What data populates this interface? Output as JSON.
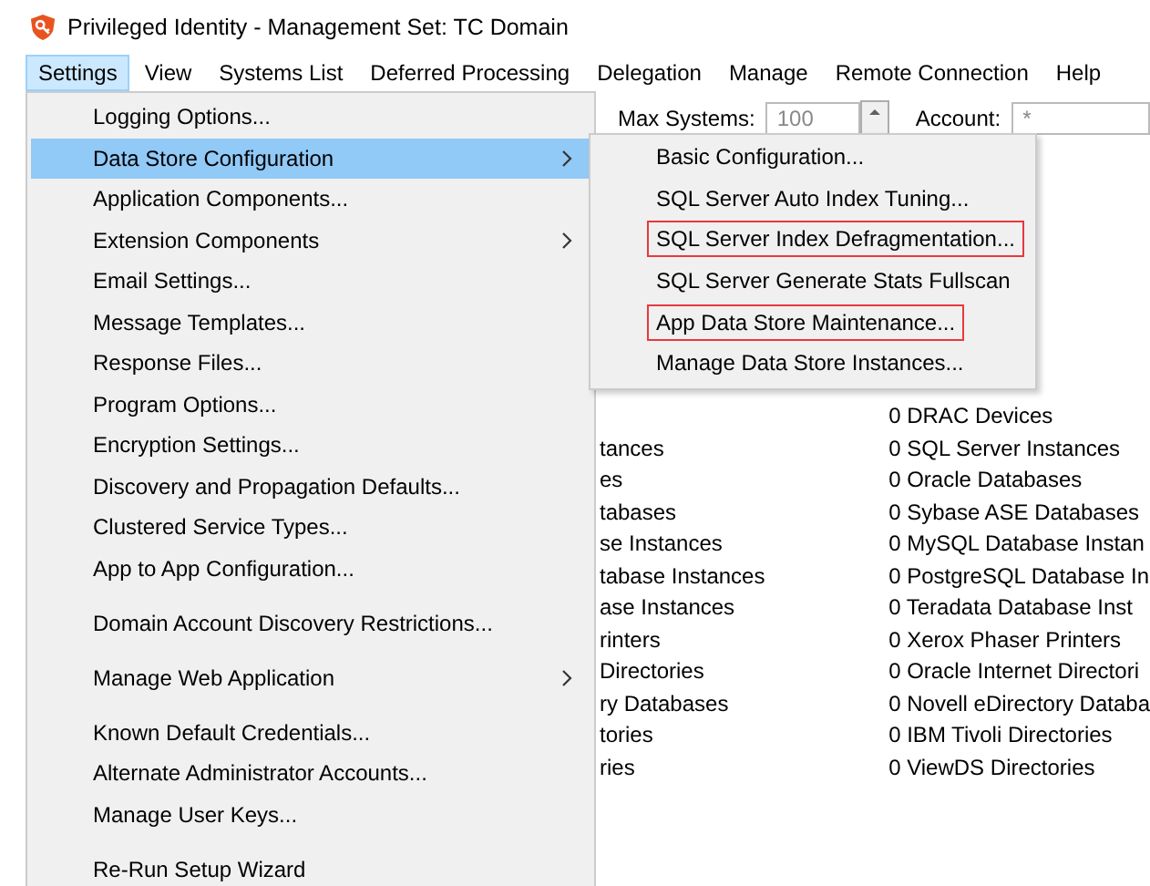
{
  "window": {
    "title": "Privileged Identity - Management Set: TC Domain"
  },
  "menu_bar": [
    {
      "label": "Settings",
      "selected": true
    },
    {
      "label": "View",
      "selected": false
    },
    {
      "label": "Systems List",
      "selected": false
    },
    {
      "label": "Deferred Processing",
      "selected": false
    },
    {
      "label": "Delegation",
      "selected": false
    },
    {
      "label": "Manage",
      "selected": false
    },
    {
      "label": "Remote Connection",
      "selected": false
    },
    {
      "label": "Help",
      "selected": false
    }
  ],
  "toolbar": {
    "max_systems_label": "Max Systems:",
    "max_systems_value": "100",
    "account_label": "Account:",
    "account_value": "*"
  },
  "list_left": [
    "tances",
    "es",
    "tabases",
    "se Instances",
    "tabase Instances",
    "ase Instances",
    "rinters",
    "Directories",
    "ry Databases",
    "tories",
    "ries"
  ],
  "list_right": [
    "0 DRAC Devices",
    "0 SQL Server Instances",
    "0 Oracle Databases",
    "0 Sybase ASE Databases",
    "0 MySQL Database Instan",
    "0 PostgreSQL Database In",
    "0 Teradata Database Inst",
    "0 Xerox Phaser Printers",
    "0 Oracle Internet Directori",
    "0 Novell eDirectory Databa",
    "0 IBM Tivoli Directories",
    "0 ViewDS Directories"
  ],
  "settings_menu": [
    {
      "kind": "item",
      "label": "Logging Options...",
      "selected": false,
      "has_submenu": false
    },
    {
      "kind": "item",
      "label": "Data Store Configuration",
      "selected": true,
      "has_submenu": true
    },
    {
      "kind": "item",
      "label": "Application Components...",
      "selected": false,
      "has_submenu": false
    },
    {
      "kind": "item",
      "label": "Extension Components",
      "selected": false,
      "has_submenu": true
    },
    {
      "kind": "item",
      "label": "Email Settings...",
      "selected": false,
      "has_submenu": false
    },
    {
      "kind": "item",
      "label": "Message Templates...",
      "selected": false,
      "has_submenu": false
    },
    {
      "kind": "item",
      "label": "Response Files...",
      "selected": false,
      "has_submenu": false
    },
    {
      "kind": "item",
      "label": "Program Options...",
      "selected": false,
      "has_submenu": false
    },
    {
      "kind": "item",
      "label": "Encryption Settings...",
      "selected": false,
      "has_submenu": false
    },
    {
      "kind": "item",
      "label": "Discovery and Propagation Defaults...",
      "selected": false,
      "has_submenu": false
    },
    {
      "kind": "item",
      "label": "Clustered Service Types...",
      "selected": false,
      "has_submenu": false
    },
    {
      "kind": "item",
      "label": "App to App Configuration...",
      "selected": false,
      "has_submenu": false
    },
    {
      "kind": "separator"
    },
    {
      "kind": "item",
      "label": "Domain Account Discovery Restrictions...",
      "selected": false,
      "has_submenu": false
    },
    {
      "kind": "separator"
    },
    {
      "kind": "item",
      "label": "Manage Web Application",
      "selected": false,
      "has_submenu": true
    },
    {
      "kind": "separator"
    },
    {
      "kind": "item",
      "label": "Known Default Credentials...",
      "selected": false,
      "has_submenu": false
    },
    {
      "kind": "item",
      "label": "Alternate Administrator Accounts...",
      "selected": false,
      "has_submenu": false
    },
    {
      "kind": "item",
      "label": "Manage User Keys...",
      "selected": false,
      "has_submenu": false
    },
    {
      "kind": "separator"
    },
    {
      "kind": "item",
      "label": "Re-Run Setup Wizard",
      "selected": false,
      "has_submenu": false
    }
  ],
  "submenu": [
    {
      "label": "Basic Configuration...",
      "outlined": false
    },
    {
      "label": "SQL Server Auto Index Tuning...",
      "outlined": false
    },
    {
      "label": "SQL Server Index Defragmentation...",
      "outlined": true
    },
    {
      "label": "SQL Server Generate Stats Fullscan",
      "outlined": false
    },
    {
      "label": "App Data Store Maintenance...",
      "outlined": true
    },
    {
      "label": "Manage Data Store Instances...",
      "outlined": false
    }
  ]
}
